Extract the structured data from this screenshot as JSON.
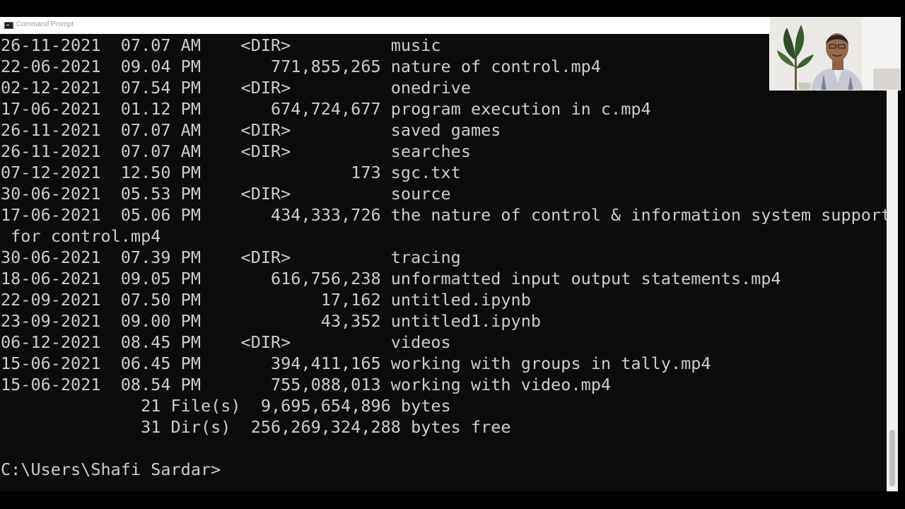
{
  "window": {
    "title": "Command Prompt",
    "icon": "console-app-icon"
  },
  "console": {
    "lines": [
      "26-11-2021  07.07 AM    <DIR>          music",
      "22-06-2021  09.04 PM       771,855,265 nature of control.mp4",
      "02-12-2021  07.54 PM    <DIR>          onedrive",
      "17-06-2021  01.12 PM       674,724,677 program execution in c.mp4",
      "26-11-2021  07.07 AM    <DIR>          saved games",
      "26-11-2021  07.07 AM    <DIR>          searches",
      "07-12-2021  12.50 PM               173 sgc.txt",
      "30-06-2021  05.53 PM    <DIR>          source",
      "17-06-2021  05.06 PM       434,333,726 the nature of control & information system support",
      " for control.mp4",
      "30-06-2021  07.39 PM    <DIR>          tracing",
      "18-06-2021  09.05 PM       616,756,238 unformatted input output statements.mp4",
      "22-09-2021  07.50 PM            17,162 untitled.ipynb",
      "23-09-2021  09.00 PM            43,352 untitled1.ipynb",
      "06-12-2021  08.45 PM    <DIR>          videos",
      "15-06-2021  06.45 PM       394,411,165 working with groups in tally.mp4",
      "15-06-2021  08.54 PM       755,088,013 working with video.mp4",
      "              21 File(s)  9,695,654,896 bytes",
      "              31 Dir(s)  256,269,324,288 bytes free",
      "",
      "C:\\Users\\Shafi Sardar>"
    ]
  },
  "colors": {
    "console_background": "#0c0c0c",
    "console_text": "#cccccc",
    "titlebar_background": "#ffffff",
    "titlebar_text": "#9a9a9a"
  }
}
